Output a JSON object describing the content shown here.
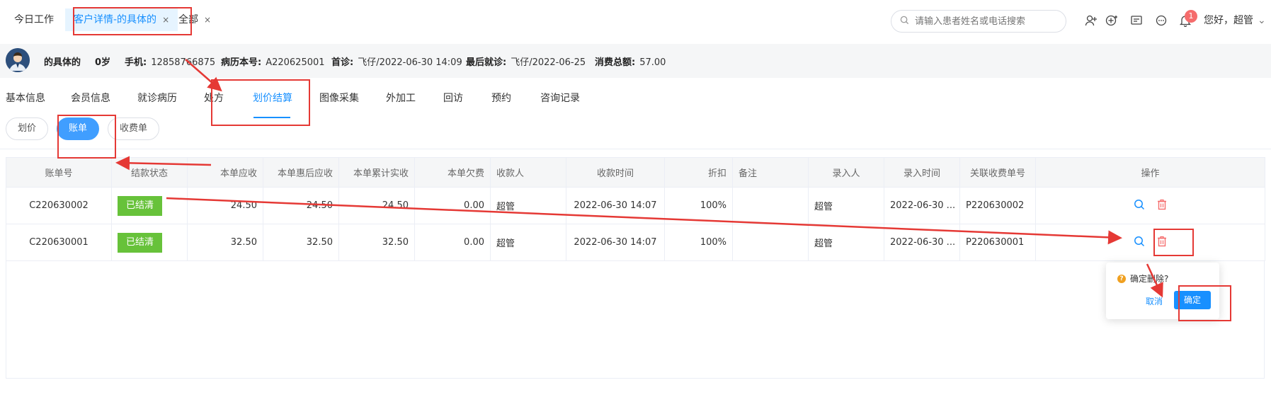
{
  "tabs": [
    {
      "label": "今日工作"
    },
    {
      "label": "客户详情-的具体的",
      "close": "×"
    },
    {
      "label": "全部",
      "close": "×"
    }
  ],
  "search": {
    "placeholder": "请输入患者姓名或电话搜索"
  },
  "notifications": {
    "count": "1"
  },
  "user": {
    "greeting": "您好，超管"
  },
  "patient": {
    "name": "的具体的",
    "age": "0岁",
    "phone_label": "手机:",
    "phone": "12858766875",
    "record_label": "病历本号:",
    "record": "A220625001",
    "first_visit_label": "首诊:",
    "first_visit": "飞仔/2022-06-30 14:09",
    "last_visit_label": "最后就诊:",
    "last_visit": "飞仔/2022-06-25",
    "total_label": "消费总额:",
    "total": "57.00"
  },
  "nav": [
    "基本信息",
    "会员信息",
    "就诊病历",
    "处方",
    "划价结算",
    "图像采集",
    "外加工",
    "回访",
    "预约",
    "咨询记录"
  ],
  "segments": [
    "划价",
    "账单",
    "收费单"
  ],
  "table": {
    "headers": [
      "账单号",
      "结款状态",
      "本单应收",
      "本单惠后应收",
      "本单累计实收",
      "本单欠费",
      "收款人",
      "收款时间",
      "折扣",
      "备注",
      "录入人",
      "录入时间",
      "关联收费单号",
      "操作"
    ],
    "rows": [
      {
        "id": "C220630002",
        "status": "已结清",
        "due": "24.50",
        "after": "24.50",
        "paid": "24.50",
        "owed": "0.00",
        "payee": "超管",
        "time": "2022-06-30 14:07",
        "discount": "100%",
        "note": "",
        "entry": "超管",
        "entry_time": "2022-06-30 ...",
        "ref": "P220630002"
      },
      {
        "id": "C220630001",
        "status": "已结清",
        "due": "32.50",
        "after": "32.50",
        "paid": "32.50",
        "owed": "0.00",
        "payee": "超管",
        "time": "2022-06-30 14:07",
        "discount": "100%",
        "note": "",
        "entry": "超管",
        "entry_time": "2022-06-30 ...",
        "ref": "P220630001"
      }
    ]
  },
  "popconfirm": {
    "message": "确定删除?",
    "cancel": "取消",
    "confirm": "确定"
  },
  "colors": {
    "accent": "#1890ff",
    "success": "#67c23a",
    "amount": "#f08c2c",
    "annotation": "#e53935"
  }
}
